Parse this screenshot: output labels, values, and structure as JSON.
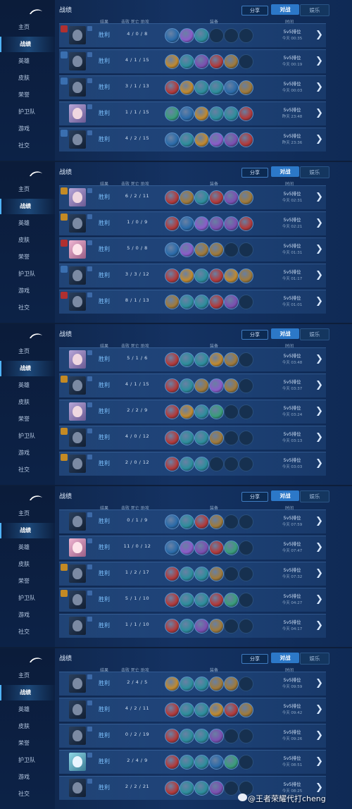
{
  "nav": [
    "主页",
    "战绩",
    "英雄",
    "皮肤",
    "荣誉",
    "护卫队",
    "游戏",
    "社交"
  ],
  "header": {
    "title": "战绩",
    "share": "分享",
    "tab_on": "对战",
    "tab_off": "娱乐"
  },
  "cols": {
    "result": "结果",
    "kda": "击败 死亡 助攻",
    "items": "装备",
    "time": "时间"
  },
  "watermark": "@王者荣耀代打cheng",
  "item_palette": [
    "#2a6aa8",
    "#8a5cc8",
    "#c0892f",
    "#2d8d9c",
    "#b23a3a",
    "#3a9d7a",
    "#7b4fb0",
    "#a07a3a"
  ],
  "panels": [
    {
      "rows": [
        {
          "hero": "f1",
          "badge": "red",
          "result": "胜利",
          "kda": "4 / 0 / 8",
          "items": [
            0,
            1,
            3,
            -1,
            -1,
            -1
          ],
          "mode": "5v5排位",
          "time": "今天 00:35"
        },
        {
          "hero": "f1",
          "badge": "blue",
          "result": "胜利",
          "kda": "4 / 1 / 15",
          "items": [
            2,
            3,
            6,
            4,
            7,
            -1
          ],
          "mode": "5v5排位",
          "time": "今天 00:19"
        },
        {
          "hero": "f1",
          "badge": "blue",
          "result": "胜利",
          "kda": "3 / 1 / 13",
          "items": [
            4,
            2,
            3,
            3,
            0,
            7
          ],
          "mode": "5v5排位",
          "time": "今天 00:03"
        },
        {
          "hero": "f2",
          "badge": "none",
          "result": "胜利",
          "kda": "1 / 1 / 15",
          "items": [
            5,
            0,
            2,
            3,
            3,
            4
          ],
          "mode": "5v5排位",
          "time": "昨天 23:48"
        },
        {
          "hero": "f1",
          "badge": "blue",
          "result": "胜利",
          "kda": "4 / 2 / 15",
          "items": [
            0,
            3,
            2,
            1,
            6,
            4
          ],
          "mode": "5v5排位",
          "time": "昨天 23:36"
        }
      ]
    },
    {
      "rows": [
        {
          "hero": "f2",
          "badge": "gold",
          "result": "胜利",
          "kda": "6 / 2 / 11",
          "items": [
            4,
            7,
            3,
            4,
            6,
            7
          ],
          "mode": "5v5排位",
          "time": "今天 02:31"
        },
        {
          "hero": "f1",
          "badge": "gold",
          "result": "胜利",
          "kda": "1 / 0 / 9",
          "items": [
            4,
            0,
            1,
            6,
            6,
            4
          ],
          "mode": "5v5排位",
          "time": "今天 02:21"
        },
        {
          "hero": "f3",
          "badge": "red",
          "result": "胜利",
          "kda": "5 / 0 / 8",
          "items": [
            0,
            1,
            7,
            7,
            -1,
            -1
          ],
          "mode": "5v5排位",
          "time": "今天 01:31"
        },
        {
          "hero": "f1",
          "badge": "blue",
          "result": "胜利",
          "kda": "3 / 3 / 12",
          "items": [
            4,
            2,
            3,
            4,
            2,
            7
          ],
          "mode": "5v5排位",
          "time": "今天 01:17"
        },
        {
          "hero": "f1",
          "badge": "red",
          "result": "胜利",
          "kda": "8 / 1 / 13",
          "items": [
            7,
            3,
            3,
            4,
            6,
            -1
          ],
          "mode": "5v5排位",
          "time": "今天 01:01"
        }
      ]
    },
    {
      "rows": [
        {
          "hero": "f2",
          "badge": "none",
          "result": "胜利",
          "kda": "5 / 1 / 6",
          "items": [
            4,
            3,
            3,
            2,
            7,
            -1
          ],
          "mode": "5v5排位",
          "time": "今天 03:48"
        },
        {
          "hero": "f1",
          "badge": "gold",
          "result": "胜利",
          "kda": "4 / 1 / 15",
          "items": [
            4,
            3,
            7,
            1,
            7,
            -1
          ],
          "mode": "5v5排位",
          "time": "今天 03:37"
        },
        {
          "hero": "f2",
          "badge": "none",
          "result": "胜利",
          "kda": "2 / 2 / 9",
          "items": [
            4,
            2,
            3,
            5,
            -1,
            -1
          ],
          "mode": "5v5排位",
          "time": "今天 03:24"
        },
        {
          "hero": "f1",
          "badge": "gold",
          "result": "胜利",
          "kda": "4 / 0 / 12",
          "items": [
            4,
            3,
            3,
            7,
            -1,
            -1
          ],
          "mode": "5v5排位",
          "time": "今天 03:13"
        },
        {
          "hero": "f1",
          "badge": "gold",
          "result": "胜利",
          "kda": "2 / 0 / 12",
          "items": [
            4,
            3,
            3,
            -1,
            -1,
            -1
          ],
          "mode": "5v5排位",
          "time": "今天 03:03"
        }
      ]
    },
    {
      "rows": [
        {
          "hero": "f1",
          "badge": "none",
          "result": "胜利",
          "kda": "0 / 1 / 9",
          "items": [
            0,
            3,
            4,
            7,
            -1,
            -1
          ],
          "mode": "5v5排位",
          "time": "今天 07:59"
        },
        {
          "hero": "f3",
          "badge": "none",
          "result": "胜利",
          "kda": "11 / 0 / 12",
          "items": [
            0,
            1,
            6,
            4,
            5,
            -1
          ],
          "mode": "5v5排位",
          "time": "今天 07:47"
        },
        {
          "hero": "f1",
          "badge": "gold",
          "result": "胜利",
          "kda": "1 / 2 / 17",
          "items": [
            4,
            3,
            3,
            7,
            -1,
            -1
          ],
          "mode": "5v5排位",
          "time": "今天 07:32"
        },
        {
          "hero": "f1",
          "badge": "gold",
          "result": "胜利",
          "kda": "5 / 1 / 10",
          "items": [
            4,
            3,
            3,
            4,
            5,
            -1
          ],
          "mode": "5v5排位",
          "time": "今天 04:27"
        },
        {
          "hero": "f1",
          "badge": "none",
          "result": "胜利",
          "kda": "1 / 1 / 10",
          "items": [
            4,
            3,
            6,
            7,
            -1,
            -1
          ],
          "mode": "5v5排位",
          "time": "今天 04:17"
        }
      ]
    },
    {
      "rows": [
        {
          "hero": "f1",
          "badge": "none",
          "result": "胜利",
          "kda": "2 / 4 / 5",
          "items": [
            2,
            3,
            3,
            7,
            7,
            -1
          ],
          "mode": "5v5排位",
          "time": "今天 09:59"
        },
        {
          "hero": "f1",
          "badge": "none",
          "result": "胜利",
          "kda": "4 / 2 / 11",
          "items": [
            4,
            3,
            3,
            2,
            4,
            7
          ],
          "mode": "5v5排位",
          "time": "今天 09:42"
        },
        {
          "hero": "f1",
          "badge": "none",
          "result": "胜利",
          "kda": "0 / 2 / 19",
          "items": [
            4,
            3,
            3,
            6,
            -1,
            -1
          ],
          "mode": "5v5排位",
          "time": "今天 09:26"
        },
        {
          "hero": "f4",
          "badge": "none",
          "result": "胜利",
          "kda": "2 / 4 / 9",
          "items": [
            4,
            3,
            3,
            0,
            5,
            -1
          ],
          "mode": "5v5排位",
          "time": "今天 08:51"
        },
        {
          "hero": "f1",
          "badge": "none",
          "result": "胜利",
          "kda": "2 / 2 / 21",
          "items": [
            4,
            3,
            3,
            6,
            -1,
            -1
          ],
          "mode": "5v5排位",
          "time": "今天 08:25"
        }
      ]
    }
  ]
}
